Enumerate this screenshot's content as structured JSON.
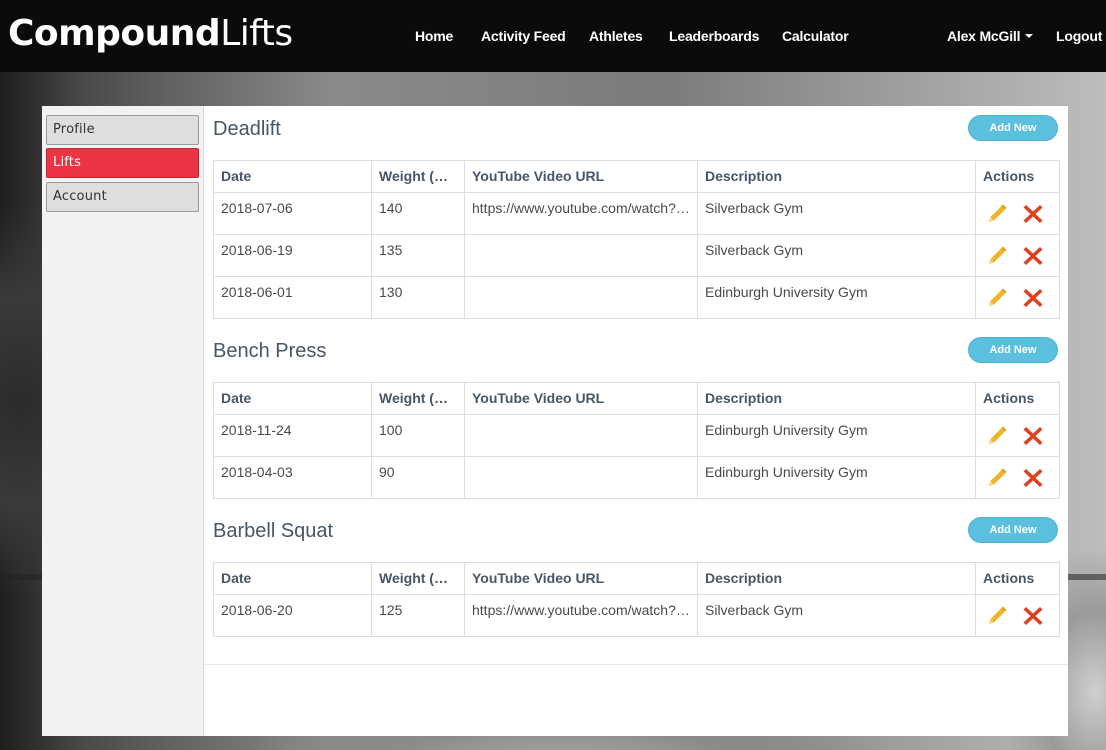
{
  "brand": {
    "bold": "Compound",
    "light": "Lifts"
  },
  "nav": {
    "links": [
      "Home",
      "Activity Feed",
      "Athletes",
      "Leaderboards",
      "Calculator"
    ],
    "user": "Alex McGill",
    "logout": "Logout"
  },
  "sidebar": {
    "items": [
      {
        "label": "Profile",
        "active": false
      },
      {
        "label": "Lifts",
        "active": true
      },
      {
        "label": "Account",
        "active": false
      }
    ]
  },
  "table_headers": [
    "Date",
    "Weight (KG)",
    "YouTube Video URL",
    "Description",
    "Actions"
  ],
  "sections": [
    {
      "title": "Deadlift",
      "add_label": "Add New",
      "rows": [
        {
          "date": "2018-07-06",
          "weight": "140",
          "url": "https://www.youtube.com/watch?v=…",
          "description": "Silverback Gym"
        },
        {
          "date": "2018-06-19",
          "weight": "135",
          "url": "",
          "description": "Silverback Gym"
        },
        {
          "date": "2018-06-01",
          "weight": "130",
          "url": "",
          "description": "Edinburgh University Gym"
        }
      ]
    },
    {
      "title": "Bench Press",
      "add_label": "Add New",
      "rows": [
        {
          "date": "2018-11-24",
          "weight": "100",
          "url": "",
          "description": "Edinburgh University Gym"
        },
        {
          "date": "2018-04-03",
          "weight": "90",
          "url": "",
          "description": "Edinburgh University Gym"
        }
      ]
    },
    {
      "title": "Barbell Squat",
      "add_label": "Add New",
      "rows": [
        {
          "date": "2018-06-20",
          "weight": "125",
          "url": "https://www.youtube.com/watch?v=-…",
          "description": "Silverback Gym"
        }
      ]
    }
  ],
  "colors": {
    "navbar": "#0b0b0b",
    "active_sidebar": "#ee3442",
    "add_button": "#5bc0de",
    "edit_icon": "#f0b429",
    "delete_icon": "#e0401f"
  },
  "icons": {
    "edit": "pencil-icon",
    "delete": "close-x-icon",
    "user_menu": "caret-down-icon"
  }
}
